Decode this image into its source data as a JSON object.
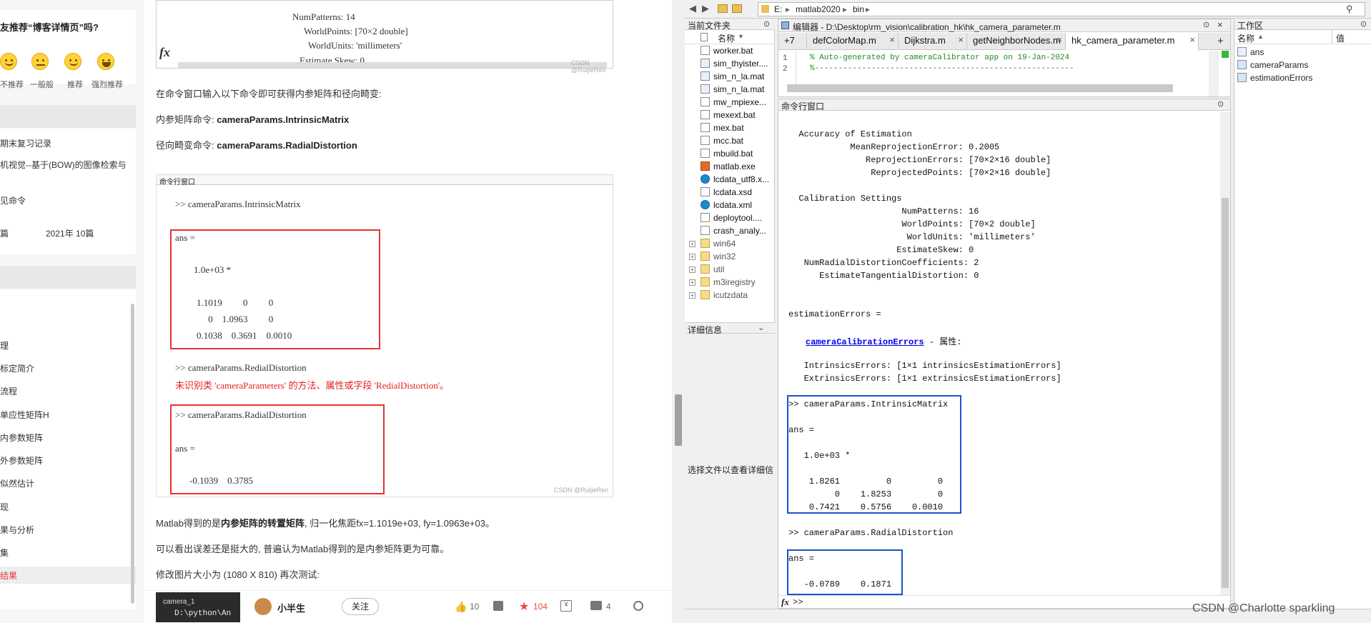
{
  "blog": {
    "sidebar": {
      "recommend_title": "友推荐“博客详情页”吗?",
      "ratings": [
        "不推荐",
        "一般般",
        "推荐",
        "强烈推荐"
      ],
      "recent_items": [
        "期末复习记录",
        "机视觉--基于(BOW)的图像检索与",
        "",
        "见命令"
      ],
      "archive_count": "篇",
      "archive_month": "2021年  10篇",
      "toc": [
        "理",
        "标定简介",
        "流程",
        "单应性矩阵H",
        "内参数矩阵",
        "外参数矩阵",
        "似然估计",
        "现",
        "果与分析",
        "集",
        "结果"
      ]
    },
    "article": {
      "top_code": {
        "lines": [
          "NumPatterns: 14",
          "WorldPoints: [70×2 double]",
          "WorldUnits: 'millimeters'",
          "Estimate Skew: 0"
        ],
        "fx": "fx",
        "watermark": "CSDN @RuijieRen"
      },
      "para1": "在命令窗口输入以下命令即可获得内参矩阵和径向畸变:",
      "para2_label": "内参矩阵命令:",
      "para2_cmd": "cameraParams.IntrinsicMatrix",
      "para3_label": "径向畸变命令:",
      "para3_cmd": "cameraParams.RadialDistortion",
      "cmd_window": {
        "title": "命令行窗口",
        "prompt1": ">> cameraParams.IntrinsicMatrix",
        "ans1": "ans =",
        "scale": "1.0e+03 *",
        "row1": "1.1019         0         0",
        "row2": "     0    1.0963         0",
        "row3": "0.1038    0.3691    0.0010",
        "prompt2": ">> cameraParams.RedialDistortion",
        "error": "未识别类 'cameraParameters' 的方法、属性或字段 'RedialDistortion'。",
        "prompt3": ">> cameraParams.RadialDistortion",
        "ans2": "ans =",
        "row4": "-0.1039    0.3785",
        "watermark": "CSDN @RuijieRen"
      },
      "para4_pre": "Matlab得到的是",
      "para4_bold": "内参矩阵的转置矩阵",
      "para4_post": ", 归一化焦距fx=1.1019e+03, fy=1.0963e+03。",
      "para5": "可以看出误差还是挺大的, 普遍认为Matlab得到的是内参矩阵更为可靠。",
      "para6": "修改图片大小为 (1080 X 810) 再次测试:"
    },
    "bottom": {
      "thumb_tab": "camera_1",
      "thumb_path": "D:\\python\\An",
      "author": "小半生",
      "follow": "关注",
      "likes": "10",
      "stars": "104",
      "comments": "4"
    }
  },
  "matlab": {
    "path": [
      "E:",
      "matlab2020",
      "bin"
    ],
    "current_folder_title": "当前文件夹",
    "name_col": "名称",
    "files": [
      {
        "name": "worker.bat",
        "type": "file"
      },
      {
        "name": "sim_thyister....",
        "type": "grid"
      },
      {
        "name": "sim_n_la.mat",
        "type": "grid"
      },
      {
        "name": "sim_n_la.mat",
        "type": "grid"
      },
      {
        "name": "mw_mpiexe...",
        "type": "file"
      },
      {
        "name": "mexext.bat",
        "type": "file"
      },
      {
        "name": "mex.bat",
        "type": "file"
      },
      {
        "name": "mcc.bat",
        "type": "file"
      },
      {
        "name": "mbuild.bat",
        "type": "file"
      },
      {
        "name": "matlab.exe",
        "type": "exe"
      },
      {
        "name": "lcdata_utf8.x...",
        "type": "edge"
      },
      {
        "name": "lcdata.xsd",
        "type": "xsd"
      },
      {
        "name": "lcdata.xml",
        "type": "edge"
      },
      {
        "name": "deploytool....",
        "type": "file"
      },
      {
        "name": "crash_analy...",
        "type": "file"
      },
      {
        "name": "win64",
        "type": "folder"
      },
      {
        "name": "win32",
        "type": "folder"
      },
      {
        "name": "util",
        "type": "folder"
      },
      {
        "name": "m3iregistry",
        "type": "folder"
      },
      {
        "name": "icutzdata",
        "type": "folder"
      }
    ],
    "details_title": "详细信息",
    "details_hint": "选择文件以查看详细信",
    "editor_title": "编辑器 - D:\\Desktop\\rm_vision\\calibration_hk\\hk_camera_parameter.m",
    "tabs": [
      "+7",
      "defColorMap.m",
      "Dijkstra.m",
      "getNeighborNodes.m",
      "hk_camera_parameter.m"
    ],
    "editor_lines": [
      "% Auto-generated by cameraCalibrator app on 19-Jan-2024",
      "%-------------------------------------------------------"
    ],
    "cmd_title": "命令行窗口",
    "cmd": {
      "l1": "  Accuracy of Estimation",
      "l2": "            MeanReprojectionError: 0.2005",
      "l3": "               ReprojectionErrors: [70×2×16 double]",
      "l4": "                ReprojectedPoints: [70×2×16 double]",
      "l5": "  Calibration Settings",
      "l6": "                      NumPatterns: 16",
      "l7": "                      WorldPoints: [70×2 double]",
      "l8": "                       WorldUnits: 'millimeters'",
      "l9": "                     EstimateSkew: 0",
      "l10": "   NumRadialDistortionCoefficients: 2",
      "l11": "      EstimateTangentialDistortion: 0",
      "l12": "estimationErrors =",
      "link": "cameraCalibrationErrors",
      "link_suffix": " - 属性:",
      "l13": "   IntrinsicsErrors: [1×1 intrinsicsEstimationErrors]",
      "l14": "   ExtrinsicsErrors: [1×1 extrinsicsEstimationErrors]",
      "p1": ">> cameraParams.IntrinsicMatrix",
      "a1": "ans =",
      "s1": "   1.0e+03 *",
      "r1": "    1.8261         0         0",
      "r2": "         0    1.8253         0",
      "r3": "    0.7421    0.5756    0.0010",
      "p2": ">> cameraParams.RadialDistortion",
      "a2": "ans =",
      "r4": "   -0.0789    0.1871",
      "prompt": ">>",
      "fx": "fx"
    },
    "workspace_title": "工作区",
    "ws_name_col": "名称",
    "ws_value_col": "值",
    "workspace": [
      "ans",
      "cameraParams",
      "estimationErrors"
    ],
    "watermark": "CSDN @Charlotte sparkling"
  }
}
